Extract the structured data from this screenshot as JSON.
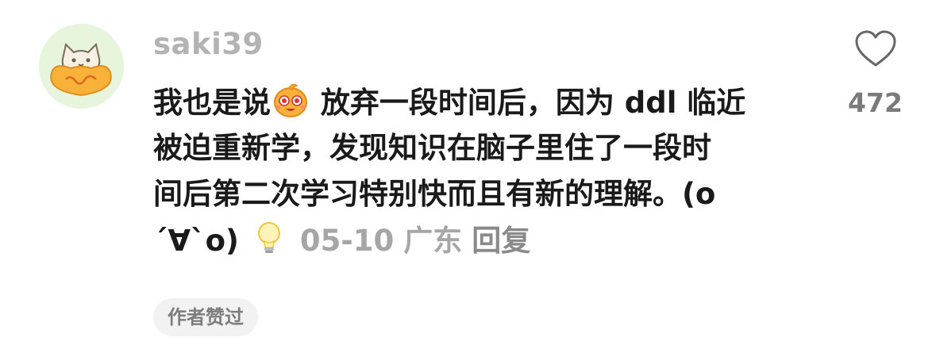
{
  "comment": {
    "username": "saki39",
    "text_lines": [
      {
        "before": "我也是说",
        "after": " 放弃一段时间后，因为 ddl 临近"
      },
      "被迫重新学，发现知识在脑子里住了一段时",
      "间后第二次学习特别快而且有新的理解。(o",
      "´∀`o)"
    ],
    "inline_emoji_1": "smiling-face-emoji",
    "inline_emoji_2": "lightbulb-emoji",
    "date": "05-10",
    "location": "广东",
    "reply_label": "回复",
    "like_count": "472",
    "author_badge": "作者赞过"
  },
  "colors": {
    "text": "#1a1a1a",
    "muted": "#b3b3b3",
    "avatar_bg": "#e6f5dc",
    "badge_bg": "#f2f2f2"
  }
}
